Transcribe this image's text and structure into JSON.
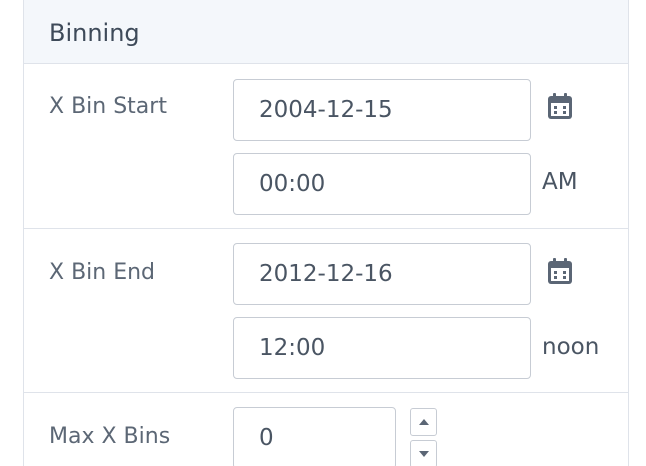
{
  "panel": {
    "title": "Binning"
  },
  "x_bin_start": {
    "label": "X Bin Start",
    "date": "2004-12-15",
    "time": "00:00",
    "time_suffix": "AM"
  },
  "x_bin_end": {
    "label": "X Bin End",
    "date": "2012-12-16",
    "time": "12:00",
    "time_suffix": "noon"
  },
  "max_x_bins": {
    "label": "Max X Bins",
    "value": "0"
  },
  "icons": {
    "calendar": "calendar-icon",
    "increment": "caret-up-icon",
    "decrement": "caret-down-icon"
  },
  "colors": {
    "header_bg": "#f4f7fb",
    "border": "#dfe3ea",
    "input_border": "#c7ccd4",
    "text": "#4a5563",
    "label": "#5c6775",
    "icon": "#5b6675"
  }
}
